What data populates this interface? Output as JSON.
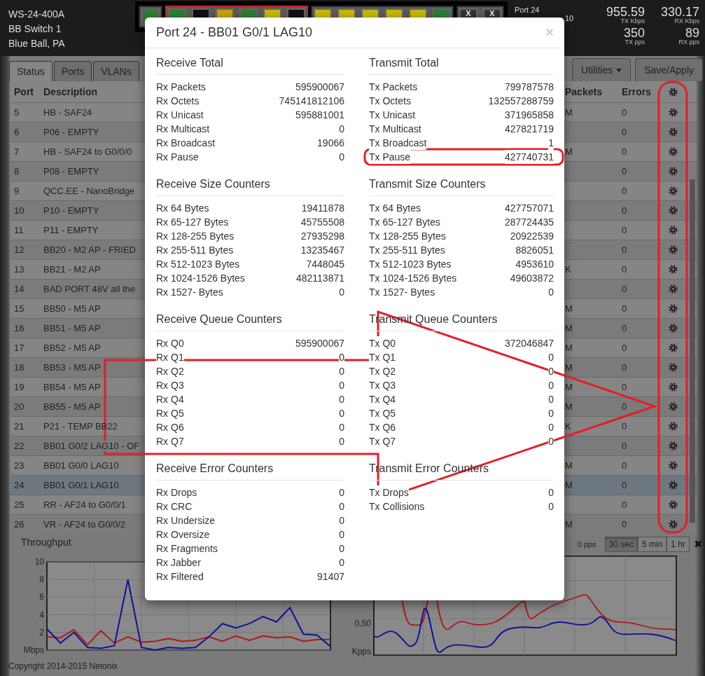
{
  "device": {
    "lines": [
      "WS-24-400A",
      "BB Switch 1",
      "Blue Ball, PA"
    ]
  },
  "port_strip": {
    "groups": [
      {
        "highlighted": false,
        "ports": [
          {
            "kind": "port",
            "color": "#2e7d32"
          }
        ]
      },
      {
        "highlighted": true,
        "ports": [
          {
            "kind": "port",
            "color": "#2e7d32"
          },
          {
            "kind": "port",
            "color": "#111111"
          },
          {
            "kind": "port",
            "color": "#c9a400"
          },
          {
            "kind": "port",
            "color": "#2e7d32"
          },
          {
            "kind": "port",
            "color": "#c9b800"
          },
          {
            "kind": "port",
            "color": "#111111"
          }
        ]
      },
      {
        "highlighted": false,
        "ports": [
          {
            "kind": "port",
            "color": "#c9b800"
          },
          {
            "kind": "port",
            "color": "#c9b800"
          },
          {
            "kind": "port",
            "color": "#c9b800"
          },
          {
            "kind": "port",
            "color": "#c9b800"
          },
          {
            "kind": "port",
            "color": "#c9b800"
          },
          {
            "kind": "port",
            "color": "#2e7d32"
          }
        ]
      },
      {
        "highlighted": false,
        "ports": [
          {
            "kind": "disabled",
            "label": "X"
          },
          {
            "kind": "disabled",
            "label": "X"
          }
        ]
      }
    ]
  },
  "port_info": {
    "title": "Port 24",
    "fragment": "10"
  },
  "stats": [
    {
      "value": "955.59",
      "label": "TX Kbps"
    },
    {
      "value": "330.17",
      "label": "RX Kbps"
    },
    {
      "value": "350",
      "label": "TX pps"
    },
    {
      "value": "89",
      "label": "RX pps"
    }
  ],
  "tabs": [
    {
      "label": "Status",
      "selected": true
    },
    {
      "label": "Ports",
      "selected": false
    },
    {
      "label": "VLANs",
      "selected": false
    }
  ],
  "actions": [
    {
      "label": "Utilities",
      "kind": "dropdown"
    },
    {
      "label": "Save/Apply",
      "kind": "button"
    }
  ],
  "table": {
    "columns": [
      "Port",
      "Description",
      "Packets",
      "Errors"
    ],
    "rows": [
      {
        "port": "5",
        "description": "HB - SAF24",
        "packets": "M",
        "errors": "0",
        "selected": false
      },
      {
        "port": "6",
        "description": "P06 - EMPTY",
        "packets": "",
        "errors": "0",
        "selected": false
      },
      {
        "port": "7",
        "description": "HB - SAF24 to G0/0/0",
        "packets": "M",
        "errors": "0",
        "selected": false
      },
      {
        "port": "8",
        "description": "P08 - EMPTY",
        "packets": "",
        "errors": "0",
        "selected": false
      },
      {
        "port": "9",
        "description": "QCC.EE - NanoBridge",
        "packets": "",
        "errors": "0",
        "selected": false
      },
      {
        "port": "10",
        "description": "P10 - EMPTY",
        "packets": "",
        "errors": "0",
        "selected": false
      },
      {
        "port": "11",
        "description": "P11 - EMPTY",
        "packets": "",
        "errors": "0",
        "selected": false
      },
      {
        "port": "12",
        "description": "BB20 - M2 AP - FRIED",
        "packets": "",
        "errors": "0",
        "selected": false
      },
      {
        "port": "13",
        "description": "BB21 - M2 AP",
        "packets": "K",
        "errors": "0",
        "selected": false
      },
      {
        "port": "14",
        "description": "BAD PORT 48V all the",
        "packets": "",
        "errors": "0",
        "selected": false
      },
      {
        "port": "15",
        "description": "BB50 - M5 AP",
        "packets": "M",
        "errors": "0",
        "selected": false
      },
      {
        "port": "16",
        "description": "BB51 - M5 AP",
        "packets": "M",
        "errors": "0",
        "selected": false
      },
      {
        "port": "17",
        "description": "BB52 - M5 AP",
        "packets": "M",
        "errors": "0",
        "selected": false
      },
      {
        "port": "18",
        "description": "BB53 - M5 AP",
        "packets": "M",
        "errors": "0",
        "selected": false
      },
      {
        "port": "19",
        "description": "BB54 - M5 AP",
        "packets": "M",
        "errors": "0",
        "selected": false
      },
      {
        "port": "20",
        "description": "BB55 - M5 AP",
        "packets": "M",
        "errors": "0",
        "selected": false
      },
      {
        "port": "21",
        "description": "P21 - TEMP BB22",
        "packets": "K",
        "errors": "0",
        "selected": false
      },
      {
        "port": "22",
        "description": "BB01 G0/2 LAG10 - OF",
        "packets": "",
        "errors": "0",
        "selected": false
      },
      {
        "port": "23",
        "description": "BB01 G0/0 LAG10",
        "packets": "M",
        "errors": "0",
        "selected": false
      },
      {
        "port": "24",
        "description": "BB01 G0/1 LAG10",
        "packets": "M",
        "errors": "0",
        "selected": true
      },
      {
        "port": "25",
        "description": "RR - AF24 to G0/0/1",
        "packets": "",
        "errors": "0",
        "selected": false
      },
      {
        "port": "26",
        "description": "VR - AF24 to G0/0/2",
        "packets": "M",
        "errors": "0",
        "selected": false
      }
    ]
  },
  "throughput": {
    "title": "Throughput",
    "chart_data": {
      "type": "line",
      "grid": true,
      "ylim": [
        0,
        10
      ],
      "yticks": [
        {
          "value": 0,
          "label": "Mbps"
        },
        2,
        4,
        6,
        8,
        10
      ],
      "series": [
        {
          "color": "#b01818",
          "values": [
            1.5,
            1.4,
            2.3,
            0.6,
            2.2,
            0.8,
            1.5,
            0.9,
            1.0,
            1.3,
            1.0,
            1.1,
            1.5,
            1.0,
            1.6,
            1.1,
            1.6,
            1.4,
            1.5,
            1.0,
            1.2,
            1.2
          ]
        },
        {
          "color": "#10109a",
          "values": [
            2.4,
            0.8,
            2.0,
            0.3,
            0.2,
            0.5,
            8.0,
            0.3,
            0.0,
            0.3,
            0.2,
            0.3,
            1.5,
            3.0,
            2.5,
            3.0,
            3.8,
            3.2,
            4.8,
            1.8,
            1.7,
            0.4
          ]
        }
      ]
    }
  },
  "pps_chart": {
    "tick": "0.50",
    "unit": "Kpps"
  },
  "range": {
    "reading": "0 pps",
    "buttons": [
      {
        "label": "30 sec",
        "selected": true
      },
      {
        "label": "5 min",
        "selected": false
      },
      {
        "label": "1 hr",
        "selected": false
      }
    ],
    "close": "✖"
  },
  "footer": "Copyright 2014-2015 Netonix",
  "modal": {
    "title": "Port 24 - BB01 G0/1 LAG10",
    "close": "×",
    "receive": [
      {
        "title": "Receive Total",
        "rows": [
          {
            "label": "Rx Packets",
            "value": "595900067"
          },
          {
            "label": "Rx Octets",
            "value": "745141812106"
          },
          {
            "label": "Rx Unicast",
            "value": "595881001"
          },
          {
            "label": "Rx Multicast",
            "value": "0"
          },
          {
            "label": "Rx Broadcast",
            "value": "19066"
          },
          {
            "label": "Rx Pause",
            "value": "0"
          }
        ]
      },
      {
        "title": "Receive Size Counters",
        "rows": [
          {
            "label": "Rx 64 Bytes",
            "value": "19411878"
          },
          {
            "label": "Rx 65-127 Bytes",
            "value": "45755508"
          },
          {
            "label": "Rx 128-255 Bytes",
            "value": "27935298"
          },
          {
            "label": "Rx 255-511 Bytes",
            "value": "13235467"
          },
          {
            "label": "Rx 512-1023 Bytes",
            "value": "7448045"
          },
          {
            "label": "Rx 1024-1526 Bytes",
            "value": "482113871"
          },
          {
            "label": "Rx 1527- Bytes",
            "value": "0"
          }
        ]
      },
      {
        "title": "Receive Queue Counters",
        "rows": [
          {
            "label": "Rx Q0",
            "value": "595900067"
          },
          {
            "label": "Rx Q1",
            "value": "0"
          },
          {
            "label": "Rx Q2",
            "value": "0"
          },
          {
            "label": "Rx Q3",
            "value": "0"
          },
          {
            "label": "Rx Q4",
            "value": "0"
          },
          {
            "label": "Rx Q5",
            "value": "0"
          },
          {
            "label": "Rx Q6",
            "value": "0"
          },
          {
            "label": "Rx Q7",
            "value": "0"
          }
        ]
      },
      {
        "title": "Receive Error Counters",
        "rows": [
          {
            "label": "Rx Drops",
            "value": "0"
          },
          {
            "label": "Rx CRC",
            "value": "0"
          },
          {
            "label": "Rx Undersize",
            "value": "0"
          },
          {
            "label": "Rx Oversize",
            "value": "0"
          },
          {
            "label": "Rx Fragments",
            "value": "0"
          },
          {
            "label": "Rx Jabber",
            "value": "0"
          },
          {
            "label": "Rx Filtered",
            "value": "91407"
          }
        ]
      }
    ],
    "transmit": [
      {
        "title": "Transmit Total",
        "rows": [
          {
            "label": "Tx Packets",
            "value": "799787578"
          },
          {
            "label": "Tx Octets",
            "value": "132557288759"
          },
          {
            "label": "Tx Unicast",
            "value": "371965858"
          },
          {
            "label": "Tx Multicast",
            "value": "427821719"
          },
          {
            "label": "Tx Broadcast",
            "value": "1"
          },
          {
            "label": "Tx Pause",
            "value": "427740731"
          }
        ]
      },
      {
        "title": "Transmit Size Counters",
        "rows": [
          {
            "label": "Tx 64 Bytes",
            "value": "427757071"
          },
          {
            "label": "Tx 65-127 Bytes",
            "value": "287724435"
          },
          {
            "label": "Tx 128-255 Bytes",
            "value": "20922539"
          },
          {
            "label": "Tx 255-511 Bytes",
            "value": "8826051"
          },
          {
            "label": "Tx 512-1023 Bytes",
            "value": "4953610"
          },
          {
            "label": "Tx 1024-1526 Bytes",
            "value": "49603872"
          },
          {
            "label": "Tx 1527- Bytes",
            "value": "0"
          }
        ]
      },
      {
        "title": "Transmit Queue Counters",
        "rows": [
          {
            "label": "Tx Q0",
            "value": "372046847"
          },
          {
            "label": "Tx Q1",
            "value": "0"
          },
          {
            "label": "Tx Q2",
            "value": "0"
          },
          {
            "label": "Tx Q3",
            "value": "0"
          },
          {
            "label": "Tx Q4",
            "value": "0"
          },
          {
            "label": "Tx Q5",
            "value": "0"
          },
          {
            "label": "Tx Q6",
            "value": "0"
          },
          {
            "label": "Tx Q7",
            "value": "0"
          }
        ]
      },
      {
        "title": "Transmit Error Counters",
        "rows": [
          {
            "label": "Tx Drops",
            "value": "0"
          },
          {
            "label": "Tx Collisions",
            "value": "0"
          }
        ]
      }
    ]
  }
}
